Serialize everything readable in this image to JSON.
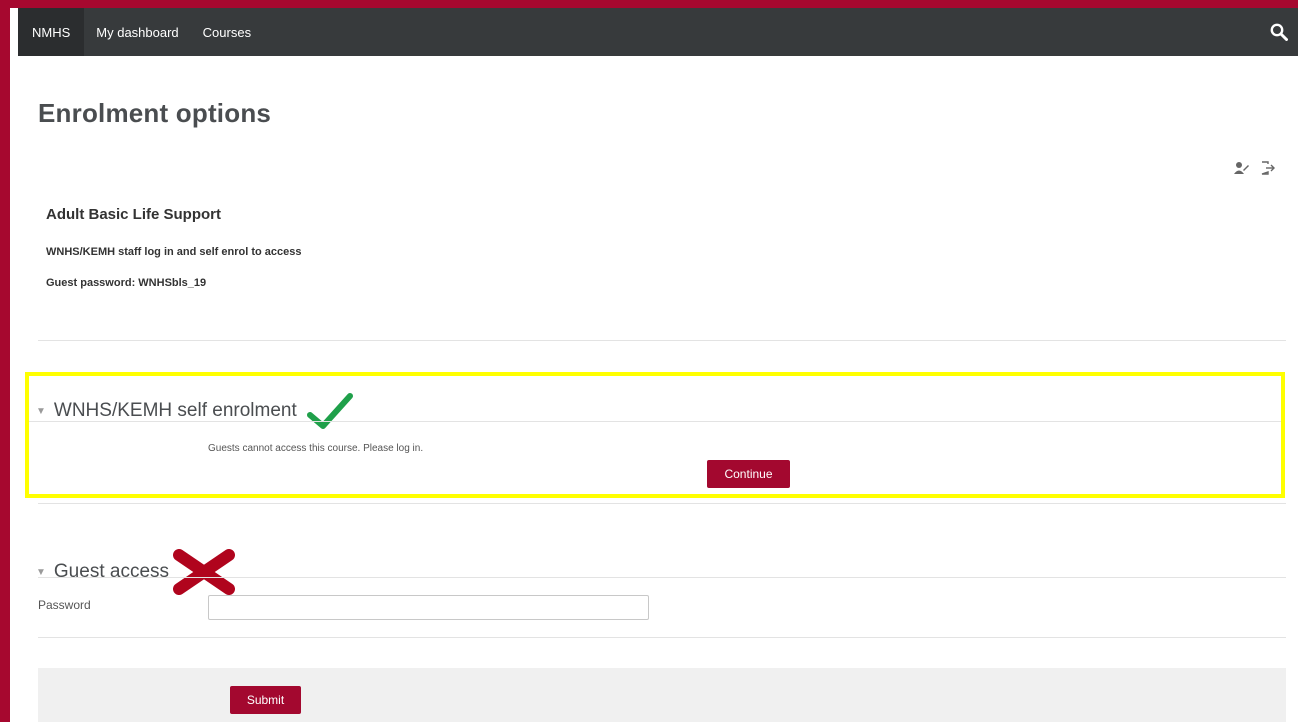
{
  "navbar": {
    "brand": "NMHS",
    "items": [
      "My dashboard",
      "Courses"
    ],
    "search_icon": "search-icon"
  },
  "page": {
    "title": "Enrolment options"
  },
  "course": {
    "name": "Adult Basic Life Support",
    "summary": [
      "WNHS/KEMH staff log in and self enrol to access",
      "Guest password: WNHSbls_19"
    ]
  },
  "self_enrolment": {
    "heading": "WNHS/KEMH self enrolment",
    "notice": "Guests cannot access this course. Please log in.",
    "continue_label": "Continue",
    "annotation_icon": "green-check-icon",
    "highlight_color": "#ffff00"
  },
  "guest_access": {
    "heading": "Guest access",
    "password_label": "Password",
    "password_value": "",
    "submit_label": "Submit",
    "annotation_icon": "red-cross-icon"
  },
  "colors": {
    "brand": "#a6082f",
    "navbar": "#373a3c",
    "check": "#1fa04a",
    "cross": "#b0041d"
  }
}
